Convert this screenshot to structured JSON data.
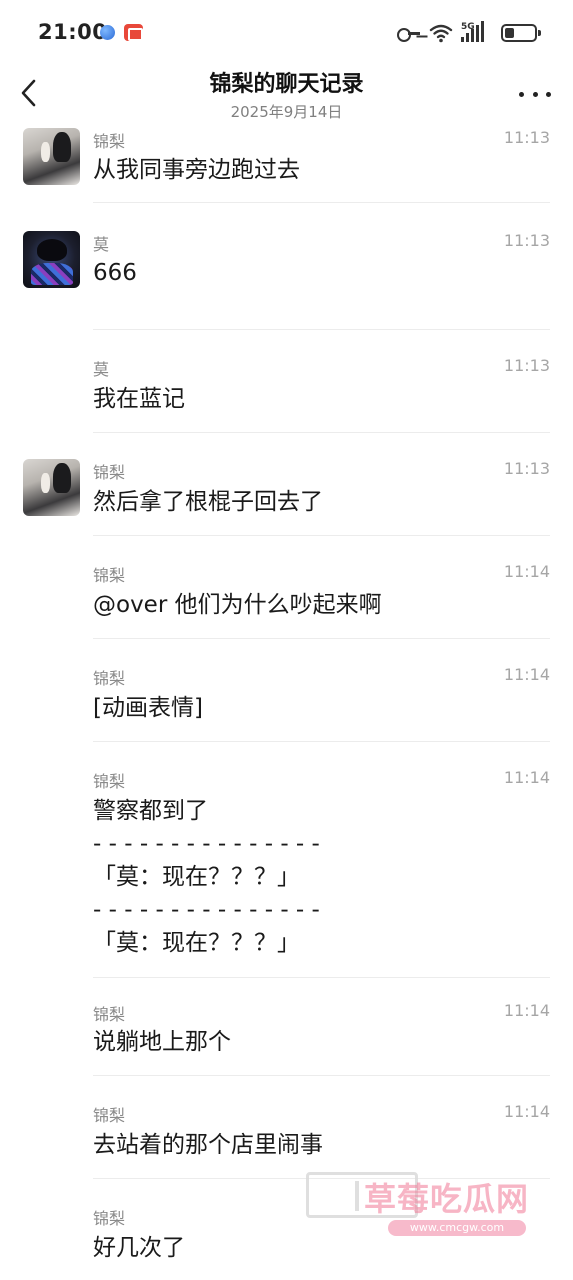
{
  "status_bar": {
    "time": "21:00",
    "network": "5G",
    "icons": [
      "browser-app-icon",
      "red-app-icon",
      "key-icon",
      "wifi-icon",
      "signal-icon",
      "battery-icon"
    ]
  },
  "header": {
    "title": "锦梨的聊天记录",
    "subtitle": "2025年9月14日",
    "back_icon": "chevron-left-icon",
    "more_icon": "more-dots-icon"
  },
  "messages": [
    {
      "sender": "锦梨",
      "time": "11:13",
      "text": "从我同事旁边跑过去",
      "avatar": "jinli"
    },
    {
      "sender": "莫",
      "time": "11:13",
      "text": "666",
      "avatar": "mo"
    },
    {
      "sender": "莫",
      "time": "11:13",
      "text": "我在蓝记",
      "avatar": ""
    },
    {
      "sender": "锦梨",
      "time": "11:13",
      "text": "然后拿了根棍子回去了",
      "avatar": "jinli"
    },
    {
      "sender": "锦梨",
      "time": "11:14",
      "text": "@over 他们为什么吵起来啊",
      "avatar": ""
    },
    {
      "sender": "锦梨",
      "time": "11:14",
      "text": "[动画表情]",
      "avatar": ""
    },
    {
      "sender": "锦梨",
      "time": "11:14",
      "text": "警察都到了\n- - - - - - - - - - - - - - -\n「莫：现在？？？」\n- - - - - - - - - - - - - - -\n「莫：现在？？？」",
      "avatar": ""
    },
    {
      "sender": "锦梨",
      "time": "11:14",
      "text": "说躺地上那个",
      "avatar": ""
    },
    {
      "sender": "锦梨",
      "time": "11:14",
      "text": "去站着的那个店里闹事",
      "avatar": ""
    },
    {
      "sender": "锦梨",
      "time": "",
      "text": "好几次了",
      "avatar": ""
    }
  ],
  "watermark": {
    "text": "草莓吃瓜网",
    "url": "www.cmcgw.com"
  },
  "colors": {
    "background": "#ffffff",
    "sender": "#8a8a8a",
    "time": "#a6a6a6",
    "divider": "#ececec"
  }
}
